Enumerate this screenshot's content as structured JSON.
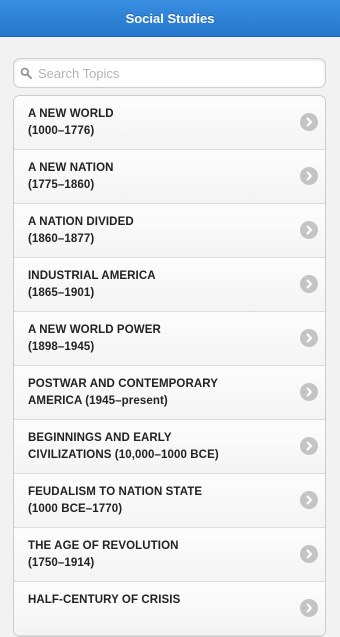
{
  "header": {
    "title": "Social Studies"
  },
  "search": {
    "placeholder": "Search Topics",
    "value": ""
  },
  "topics": [
    {
      "line1": "A NEW WORLD",
      "line2": "(1000–1776)"
    },
    {
      "line1": "A NEW NATION",
      "line2": "(1775–1860)"
    },
    {
      "line1": "A NATION DIVIDED",
      "line2": "(1860–1877)"
    },
    {
      "line1": "INDUSTRIAL AMERICA",
      "line2": "(1865–1901)"
    },
    {
      "line1": "A NEW WORLD POWER",
      "line2": "(1898–1945)"
    },
    {
      "line1": "POSTWAR AND CONTEMPORARY",
      "line2": "AMERICA (1945–present)"
    },
    {
      "line1": "BEGINNINGS AND EARLY",
      "line2": "CIVILIZATIONS (10,000–1000 BCE)"
    },
    {
      "line1": "FEUDALISM TO NATION STATE",
      "line2": "(1000 BCE–1770)"
    },
    {
      "line1": "THE AGE OF REVOLUTION",
      "line2": "(1750–1914)"
    },
    {
      "line1": "HALF-CENTURY OF CRISIS",
      "line2": ""
    }
  ],
  "icons": {
    "search": "search-icon",
    "chevron": "chevron-right-icon"
  },
  "colors": {
    "header": "#2a7fd4",
    "chevron": "#c4c4c4"
  }
}
